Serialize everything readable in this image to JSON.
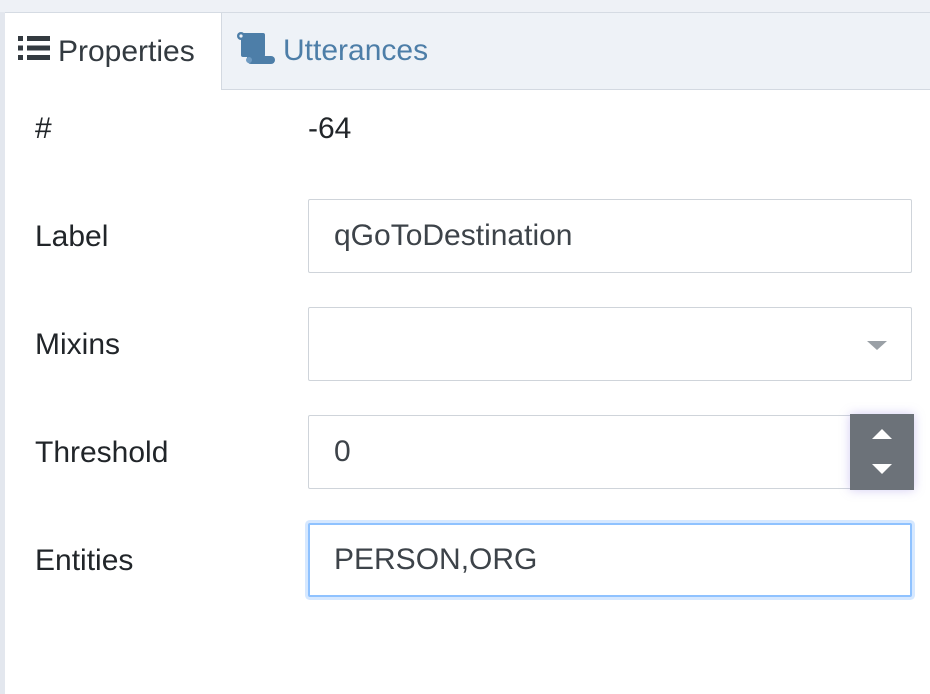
{
  "tabs": [
    {
      "label": "Properties",
      "icon": "list-icon",
      "active": true
    },
    {
      "label": "Utterances",
      "icon": "scroll-icon",
      "active": false
    }
  ],
  "form": {
    "id": {
      "label": "#",
      "value": "-64"
    },
    "label": {
      "label": "Label",
      "value": "qGoToDestination"
    },
    "mixins": {
      "label": "Mixins",
      "value": ""
    },
    "threshold": {
      "label": "Threshold",
      "value": "0"
    },
    "entities": {
      "label": "Entities",
      "value": "PERSON,ORG"
    }
  },
  "colors": {
    "active_tab_text": "#333a40",
    "inactive_tab_text": "#4d7ea8",
    "focus_border": "#8fc2ff",
    "stepper_bg": "#6c7279"
  }
}
